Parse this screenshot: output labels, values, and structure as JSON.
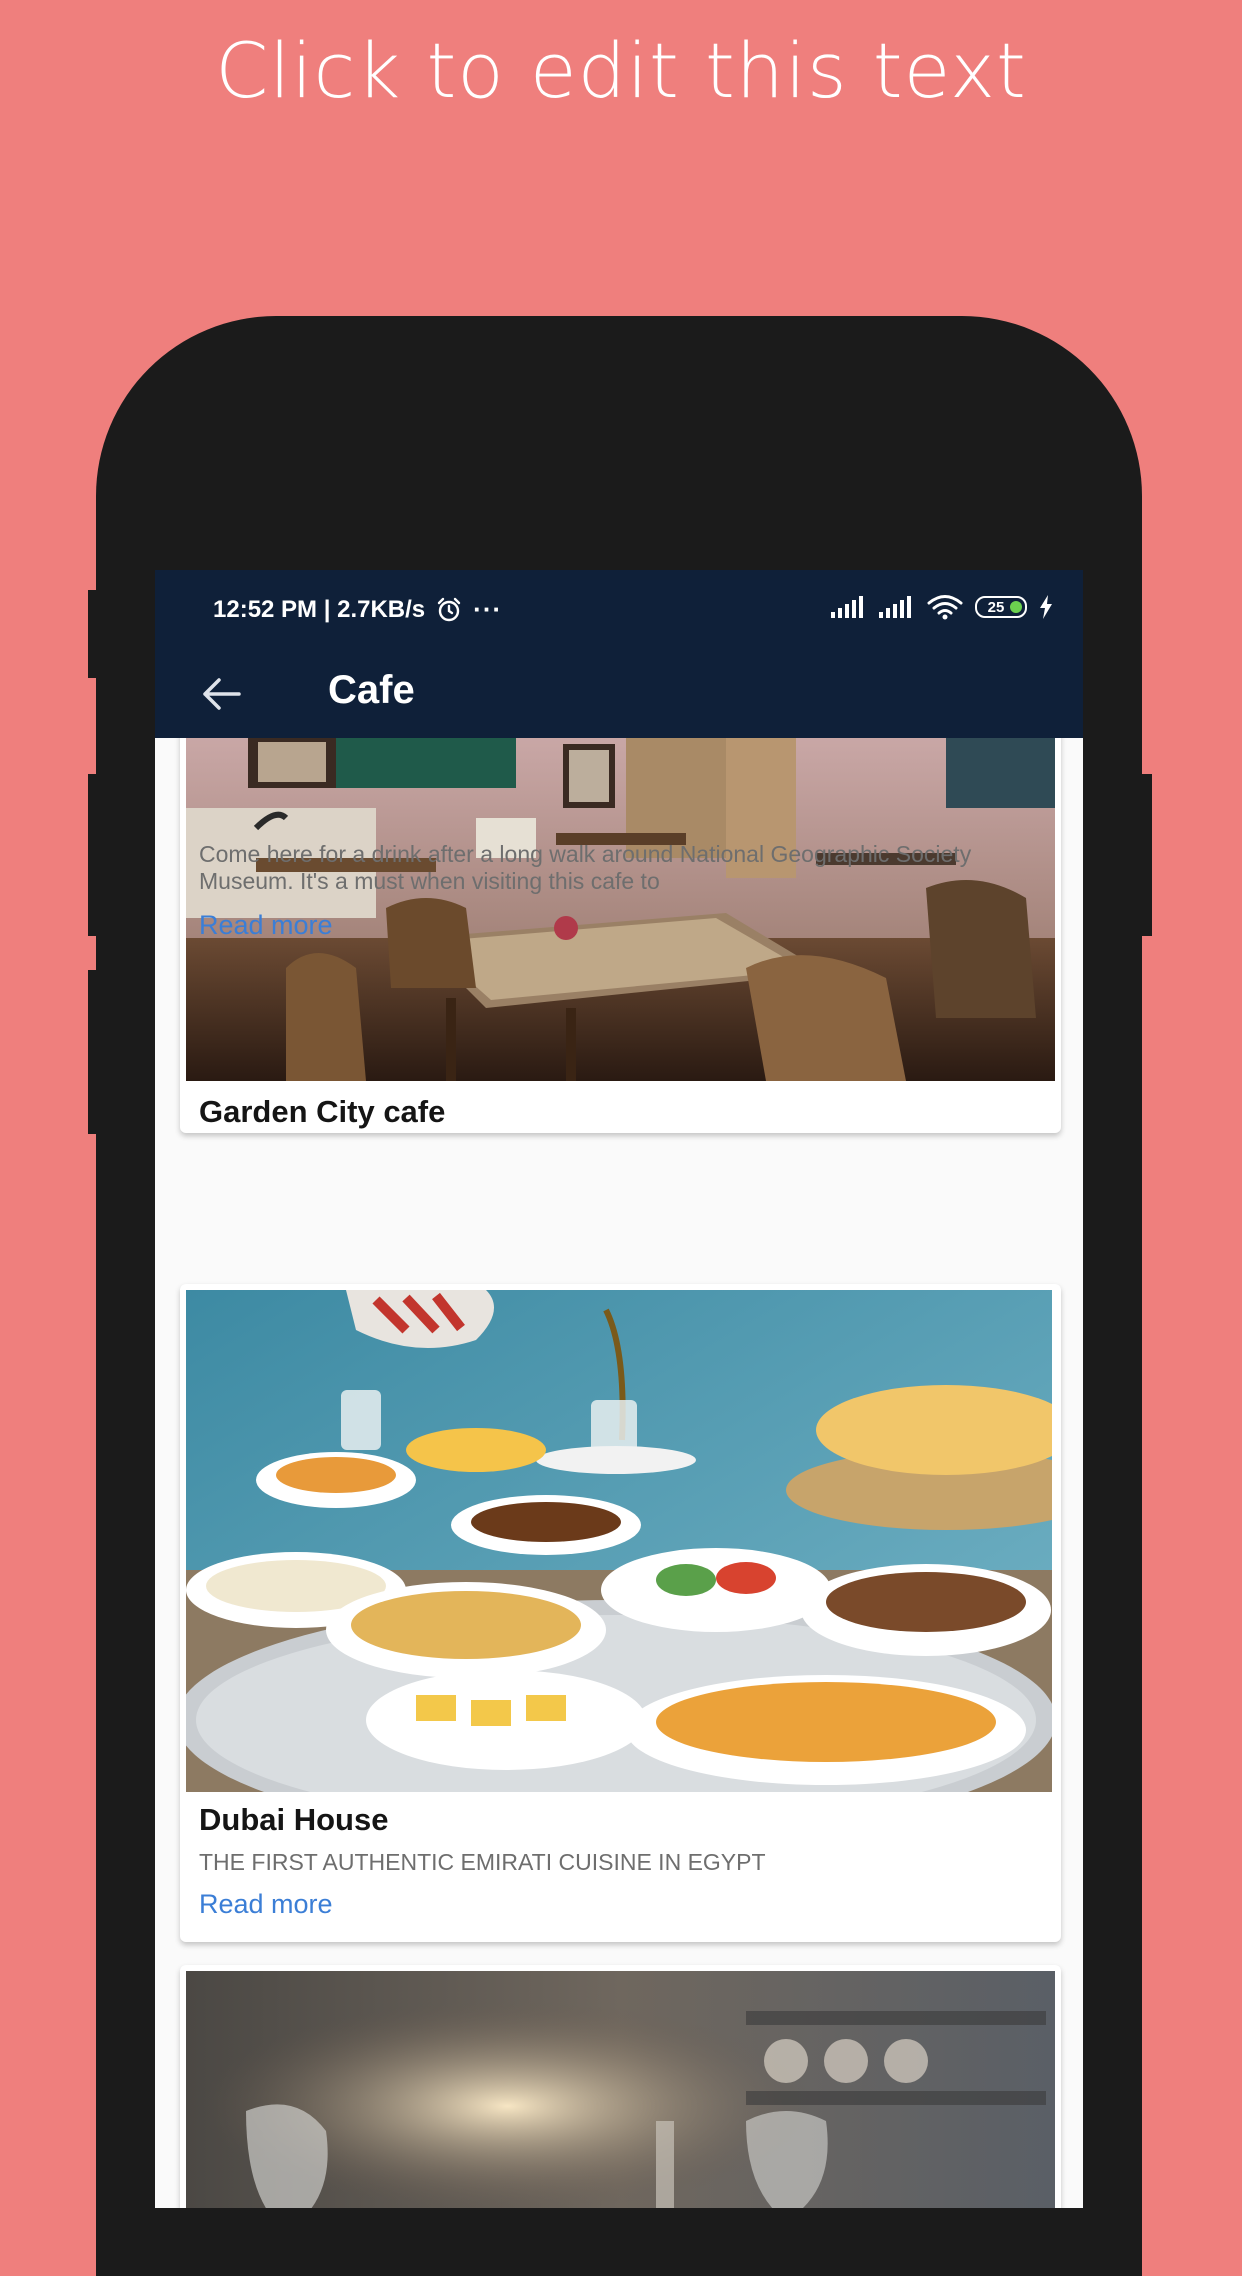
{
  "promo": {
    "headline": "Click to edit this text"
  },
  "status_bar": {
    "time_speed": "12:52 PM | 2.7KB/s",
    "more": "···",
    "battery": "25"
  },
  "app_bar": {
    "title": "Cafe"
  },
  "cards": [
    {
      "title": "Garden City cafe",
      "description": "Come here for a drink after a long walk around National Geographic Society Museum. It's a must when visiting this cafe to",
      "read_more": "Read more"
    },
    {
      "title": "Dubai House",
      "description": "THE FIRST AUTHENTIC EMIRATI CUISINE IN EGYPT",
      "read_more": "Read more"
    },
    {
      "title": "",
      "description": "",
      "read_more": ""
    }
  ],
  "colors": {
    "background": "#ef7f7d",
    "app_bar": "#0f2039",
    "link": "#3b7ed6",
    "battery_fill": "#6cd14f"
  }
}
